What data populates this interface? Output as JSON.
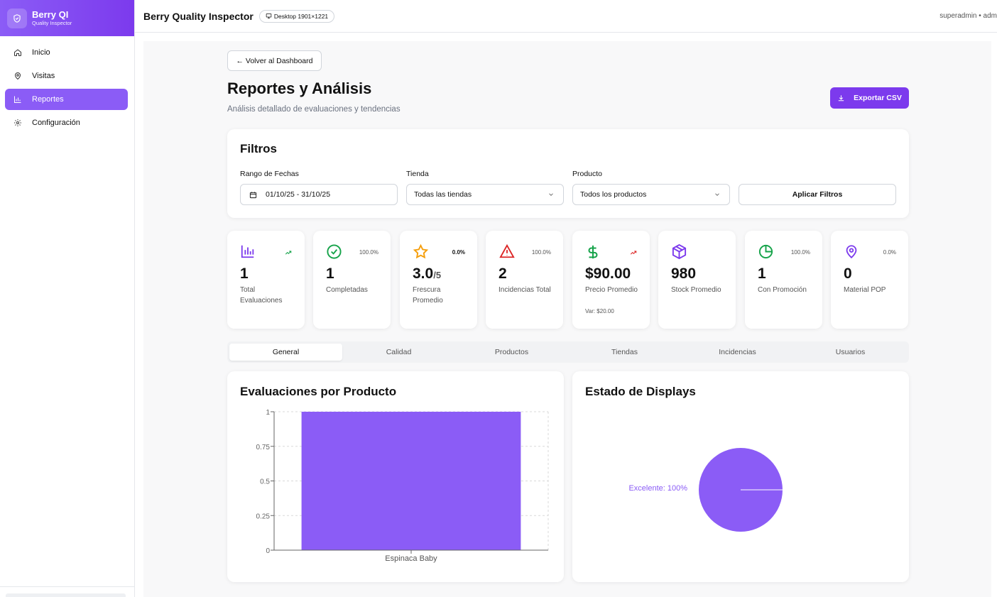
{
  "brand": {
    "title": "Berry QI",
    "subtitle": "Quality Inspector"
  },
  "nav": [
    {
      "label": "Inicio",
      "icon": "home-icon"
    },
    {
      "label": "Visitas",
      "icon": "map-pin-icon"
    },
    {
      "label": "Reportes",
      "icon": "bar-chart-icon",
      "active": true
    },
    {
      "label": "Configuración",
      "icon": "gear-icon"
    }
  ],
  "topbar": {
    "title": "Berry Quality Inspector",
    "device": "Desktop 1901×1221",
    "user": "superadmin • adm"
  },
  "page": {
    "back": "← Volver al Dashboard",
    "title": "Reportes y Análisis",
    "subtitle": "Análisis detallado de evaluaciones y tendencias",
    "export": "Exportar CSV"
  },
  "filters": {
    "title": "Filtros",
    "date_label": "Rango de Fechas",
    "date_value": "01/10/25 - 31/10/25",
    "store_label": "Tienda",
    "store_value": "Todas las tiendas",
    "product_label": "Producto",
    "product_value": "Todos los productos",
    "apply": "Aplicar Filtros"
  },
  "stats": [
    {
      "value": "1",
      "label": "Total Evaluaciones",
      "trend": "",
      "icon": "bar-chart-icon",
      "color": "#7c3aed"
    },
    {
      "value": "1",
      "label": "Completadas",
      "trend": "100.0%",
      "icon": "check-circle-icon",
      "color": "#16a34a"
    },
    {
      "value": "3.0",
      "suffix": "/5",
      "label": "Frescura Promedio",
      "trend": "0.0%",
      "icon": "star-icon",
      "color": "#f59e0b"
    },
    {
      "value": "2",
      "label": "Incidencias Total",
      "trend": "100.0%",
      "icon": "alert-triangle-icon",
      "color": "#dc2626"
    },
    {
      "value": "$90.00",
      "label": "Precio Promedio",
      "extra": "Var: $20.00",
      "trend": "",
      "icon": "dollar-icon",
      "color": "#16a34a"
    },
    {
      "value": "980",
      "label": "Stock Promedio",
      "trend": "",
      "icon": "box-icon",
      "color": "#7c3aed"
    },
    {
      "value": "1",
      "label": "Con Promoción",
      "trend": "100.0%",
      "icon": "pie-icon",
      "color": "#16a34a"
    },
    {
      "value": "0",
      "label": "Material POP",
      "trend": "0.0%",
      "icon": "map-pin-icon",
      "color": "#7c3aed"
    }
  ],
  "tabs": [
    "General",
    "Calidad",
    "Productos",
    "Tiendas",
    "Incidencias",
    "Usuarios"
  ],
  "charts": {
    "products_title": "Evaluaciones por Producto",
    "displays_title": "Estado de Displays"
  },
  "chart_data": [
    {
      "type": "bar",
      "title": "Evaluaciones por Producto",
      "categories": [
        "Espinaca Baby"
      ],
      "values": [
        1
      ],
      "ylim": [
        0,
        1
      ],
      "yticks": [
        "0",
        "0.25",
        "0.5",
        "0.75",
        "1"
      ],
      "grid": true,
      "color": "#8b5cf6"
    },
    {
      "type": "pie",
      "title": "Estado de Displays",
      "labels": [
        "Excelente"
      ],
      "values": [
        100
      ],
      "slice_labels": [
        "Excelente: 100%"
      ],
      "color": "#8b5cf6"
    }
  ]
}
